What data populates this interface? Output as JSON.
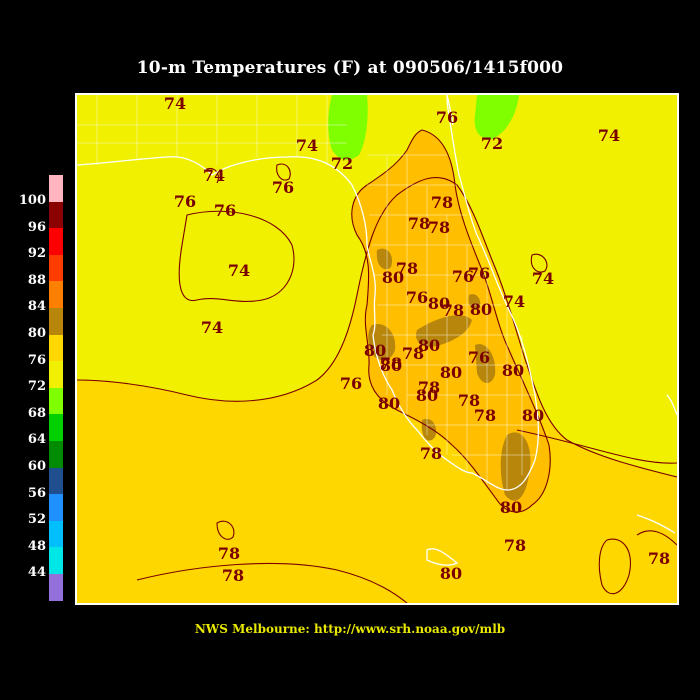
{
  "title": "10-m Temperatures (F) at 090506/1415f000",
  "credit": "NWS Melbourne: http://www.srh.noaa.gov/mlb",
  "legend": {
    "labels": [
      "100",
      "96",
      "92",
      "88",
      "84",
      "80",
      "76",
      "72",
      "68",
      "64",
      "60",
      "56",
      "52",
      "48",
      "44"
    ],
    "colors": [
      "#ffb6c1",
      "#8b0000",
      "#ff0000",
      "#ff3c00",
      "#ff7f00",
      "#b8860b",
      "#ffd700",
      "#f0f000",
      "#7fff00",
      "#00d000",
      "#008b00",
      "#1f4f8f",
      "#1e90ff",
      "#00bfff",
      "#00e5e5",
      "#9370db"
    ]
  },
  "map": {
    "colors": {
      "gulf_76_78": "#ffd700",
      "land_72_76": "#f0f000",
      "green_68_72": "#7fff00",
      "band_78_80": "#ffbf00",
      "band_80_84": "#b8860b",
      "contour_line": "#7a0000",
      "label_color": "#7a0000"
    },
    "labels": [
      {
        "id": "lbl-74-top",
        "text": "74"
      },
      {
        "id": "lbl-74-panhandle",
        "text": "74"
      },
      {
        "id": "lbl-72-green",
        "text": "72"
      },
      {
        "id": "lbl-76-ga",
        "text": "76"
      },
      {
        "id": "lbl-72-east",
        "text": "72"
      },
      {
        "id": "lbl-74-ne",
        "text": "74"
      },
      {
        "id": "lbl-74-bay",
        "text": "74"
      },
      {
        "id": "lbl-76-pen",
        "text": "76"
      },
      {
        "id": "lbl-76-coast",
        "text": "76"
      },
      {
        "id": "lbl-76-big",
        "text": "76"
      },
      {
        "id": "lbl-78-north",
        "text": "78"
      },
      {
        "id": "lbl-78-north2",
        "text": "78"
      },
      {
        "id": "lbl-78-north3",
        "text": "78"
      },
      {
        "id": "lbl-74-gulf",
        "text": "74"
      },
      {
        "id": "lbl-74-gulf2",
        "text": "74"
      },
      {
        "id": "lbl-74-atl",
        "text": "74"
      },
      {
        "id": "lbl-78-tampa",
        "text": "78"
      },
      {
        "id": "lbl-80-tampa",
        "text": "80"
      },
      {
        "id": "lbl-76-c1",
        "text": "76"
      },
      {
        "id": "lbl-76-c2",
        "text": "76"
      },
      {
        "id": "lbl-76-c3",
        "text": "76"
      },
      {
        "id": "lbl-80-c1",
        "text": "80"
      },
      {
        "id": "lbl-78-c1",
        "text": "78"
      },
      {
        "id": "lbl-80-orl",
        "text": "80"
      },
      {
        "id": "lbl-74-coast",
        "text": "74"
      },
      {
        "id": "lbl-78-c2",
        "text": "78"
      },
      {
        "id": "lbl-80-c2",
        "text": "80"
      },
      {
        "id": "lbl-80-sw",
        "text": "80"
      },
      {
        "id": "lbl-78-sw",
        "text": "78"
      },
      {
        "id": "lbl-80-c3",
        "text": "80"
      },
      {
        "id": "lbl-78-c3",
        "text": "78"
      },
      {
        "id": "lbl-80-c4",
        "text": "80"
      },
      {
        "id": "lbl-76-gulfcoast",
        "text": "76"
      },
      {
        "id": "lbl-80-sw2",
        "text": "80"
      },
      {
        "id": "lbl-76-c4",
        "text": "76"
      },
      {
        "id": "lbl-80-se",
        "text": "80"
      },
      {
        "id": "lbl-78-c4",
        "text": "78"
      },
      {
        "id": "lbl-80-e",
        "text": "80"
      },
      {
        "id": "lbl-78-e",
        "text": "78"
      },
      {
        "id": "lbl-80-naples",
        "text": "80"
      },
      {
        "id": "lbl-78-naples",
        "text": "78"
      },
      {
        "id": "lbl-80-miami",
        "text": "80"
      },
      {
        "id": "lbl-78-miami",
        "text": "78"
      },
      {
        "id": "lbl-78-gulfs",
        "text": "78"
      },
      {
        "id": "lbl-78-gulfs2",
        "text": "78"
      },
      {
        "id": "lbl-80-keys",
        "text": "80"
      },
      {
        "id": "lbl-78-bahamas",
        "text": "78"
      }
    ]
  }
}
